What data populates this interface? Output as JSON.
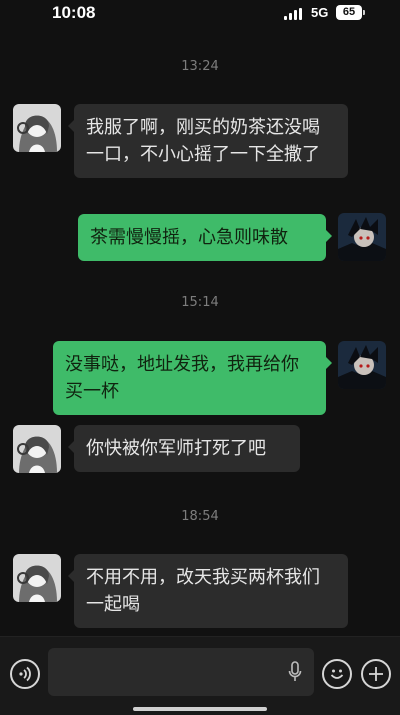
{
  "status_bar": {
    "time": "10:08",
    "network": "5G",
    "battery": "65"
  },
  "chat": {
    "time_separators": [
      "13:24",
      "15:14",
      "18:54"
    ],
    "messages": [
      {
        "side": "in",
        "text": "我服了啊，刚买的奶茶还没喝一口，不小心摇了一下全撒了"
      },
      {
        "side": "out",
        "text": "茶需慢慢摇，心急则味散"
      },
      {
        "side": "out",
        "text": "没事哒，地址发我，我再给你买一杯"
      },
      {
        "side": "in",
        "text": "你快被你军师打死了吧"
      },
      {
        "side": "in",
        "text": "不用不用，改天我买两杯我们一起喝"
      }
    ]
  },
  "input_bar": {
    "icons": [
      "voice-icon",
      "mic-icon",
      "emoji-icon",
      "plus-icon"
    ]
  },
  "colors": {
    "background": "#111111",
    "incoming_bubble": "#2c2c2c",
    "outgoing_bubble": "#3fbb69",
    "timestamp": "#7d7d7d"
  }
}
